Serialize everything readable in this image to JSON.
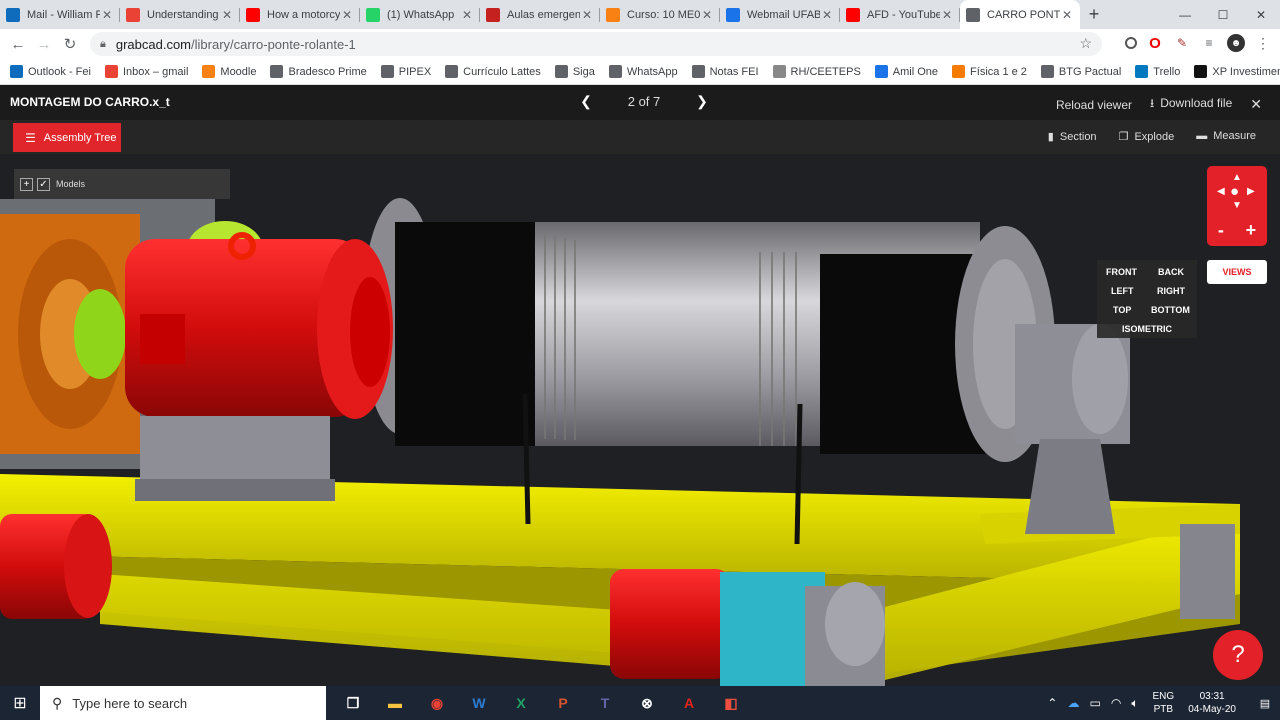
{
  "browser": {
    "tabs": [
      {
        "label": "Mail - William F",
        "icon": "outlook-icon",
        "color": "#0f6cbd"
      },
      {
        "label": "Understanding",
        "icon": "gmail-icon",
        "color": "#ea4335"
      },
      {
        "label": "How a motorcy",
        "icon": "youtube-icon",
        "color": "#ff0000"
      },
      {
        "label": "(1) WhatsApp",
        "icon": "whatsapp-icon",
        "color": "#25d366"
      },
      {
        "label": "Aulas emergen",
        "icon": "doc-icon",
        "color": "#c5221f"
      },
      {
        "label": "Curso: 10 ME0",
        "icon": "moodle-icon",
        "color": "#f98012"
      },
      {
        "label": "Webmail UFABC",
        "icon": "webmail-icon",
        "color": "#1a73e8"
      },
      {
        "label": "AFD - YouTube",
        "icon": "youtube-icon",
        "color": "#ff0000"
      },
      {
        "label": "CARRO PONTE",
        "icon": "grabcad-icon",
        "color": "#5f6368",
        "active": true
      }
    ],
    "url": {
      "host": "grabcad.com",
      "path": "/library/carro-ponte-rolante-1"
    },
    "bookmarks": [
      {
        "label": "Outlook - Fei",
        "color": "#0f6cbd"
      },
      {
        "label": "Inbox – gmail",
        "color": "#ea4335"
      },
      {
        "label": "Moodle",
        "color": "#f98012"
      },
      {
        "label": "Bradesco Prime",
        "color": "#5f6368"
      },
      {
        "label": "PIPEX",
        "color": "#5f6368"
      },
      {
        "label": "Currículo Lattes",
        "color": "#5f6368"
      },
      {
        "label": "Siga",
        "color": "#5f6368"
      },
      {
        "label": "WhatsApp",
        "color": "#5f6368"
      },
      {
        "label": "Notas FEI",
        "color": "#5f6368"
      },
      {
        "label": "RH/CEETEPS",
        "color": "#888888"
      },
      {
        "label": "Amil One",
        "color": "#1a73e8"
      },
      {
        "label": "Física 1 e 2",
        "color": "#f57c00"
      },
      {
        "label": "BTG Pactual",
        "color": "#5f6368"
      },
      {
        "label": "Trello",
        "color": "#0079bf"
      },
      {
        "label": "XP Investimentos -...",
        "color": "#111111"
      }
    ]
  },
  "viewer": {
    "title": "MONTAGEM DO CARRO.x_t",
    "pager": "2 of 7",
    "reload": "Reload viewer",
    "download": "Download file",
    "assembly_tree": "Assembly Tree",
    "tools": {
      "section": "Section",
      "explode": "Explode",
      "measure": "Measure"
    },
    "models_label": "Models",
    "views_button": "VIEWS",
    "views": {
      "front": "FRONT",
      "back": "BACK",
      "left": "LEFT",
      "right": "RIGHT",
      "top": "TOP",
      "bottom": "BOTTOM",
      "isometric": "ISOMETRIC"
    },
    "help": "?",
    "accent": "#e32128"
  },
  "taskbar": {
    "search_placeholder": "Type here to search",
    "lang": "ENG",
    "layout": "PTB",
    "time": "03:31",
    "date": "04-May-20"
  }
}
